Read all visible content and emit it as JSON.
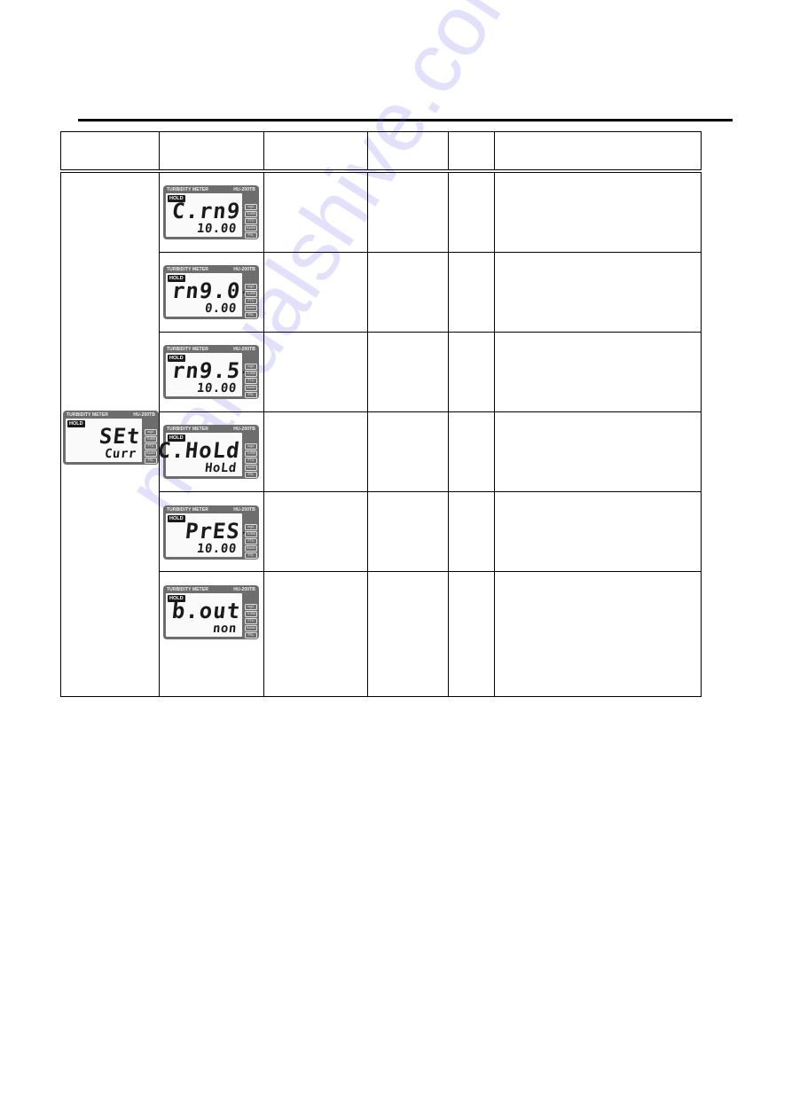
{
  "document": {
    "table": {
      "header": [
        "",
        "",
        "",
        "",
        "",
        ""
      ],
      "main_menu_display": {
        "model_label": "TURBIDITY METER",
        "model_code": "HU-200TB",
        "hold": "HOLD",
        "main": "SEt",
        "sub": "Curr",
        "units": [
          "mg/L",
          "TURB",
          "FTU",
          "Kaolin",
          "PSL"
        ]
      },
      "rows": [
        {
          "display": {
            "model_label": "TURBIDITY METER",
            "model_code": "HU-200TB",
            "hold": "HOLD",
            "main": "C.rn9",
            "sub": "10.00",
            "arrow": false,
            "units": [
              "mg/L",
              "TURB",
              "FTU",
              "Kaolin",
              "PSL"
            ]
          },
          "col3": "",
          "col4": "",
          "col5": "",
          "col6": ""
        },
        {
          "display": {
            "model_label": "TURBIDITY METER",
            "model_code": "HU-200TB",
            "hold": "HOLD",
            "main": "rn9.0",
            "sub": "0.00",
            "arrow": true,
            "units": [
              "mg/L",
              "TURB",
              "FTU",
              "Kaolin",
              "PSL"
            ]
          },
          "col3": "",
          "col4": "",
          "col5": "",
          "col6": ""
        },
        {
          "display": {
            "model_label": "TURBIDITY METER",
            "model_code": "HU-200TB",
            "hold": "HOLD",
            "main": "rn9.5",
            "sub": "10.00",
            "arrow": true,
            "units": [
              "mg/L",
              "TURB",
              "FTU",
              "Kaolin",
              "PSL"
            ]
          },
          "col3": "",
          "col4": "",
          "col5": "",
          "col6": ""
        },
        {
          "display": {
            "model_label": "TURBIDITY METER",
            "model_code": "HU-200TB",
            "hold": "HOLD",
            "main": "C.HoLd",
            "sub": "HoLd",
            "arrow": false,
            "units": [
              "mg/L",
              "TURB",
              "FTU",
              "Kaolin",
              "PSL"
            ]
          },
          "col3": "",
          "col4": "",
          "col5": "",
          "col6": ""
        },
        {
          "display": {
            "model_label": "TURBIDITY METER",
            "model_code": "HU-200TB",
            "hold": "HOLD",
            "main": "PrES",
            "sub": "10.00",
            "arrow": true,
            "units": [
              "mg/L",
              "TURB",
              "FTU",
              "Kaolin",
              "PSL"
            ]
          },
          "col3": "",
          "col4": "",
          "col5": "",
          "col6": ""
        },
        {
          "display": {
            "model_label": "TURBIDITY METER",
            "model_code": "HU-200TB",
            "hold": "HOLD",
            "main": "b.out",
            "sub": "non",
            "arrow": false,
            "units": [
              "mg/L",
              "TURB",
              "FTU",
              "Kaolin",
              "PSL"
            ]
          },
          "col3": "",
          "col4": "",
          "col5": "",
          "col6": ""
        }
      ]
    },
    "watermark": "manualshive.com",
    "arrow_glyph": "▸"
  }
}
